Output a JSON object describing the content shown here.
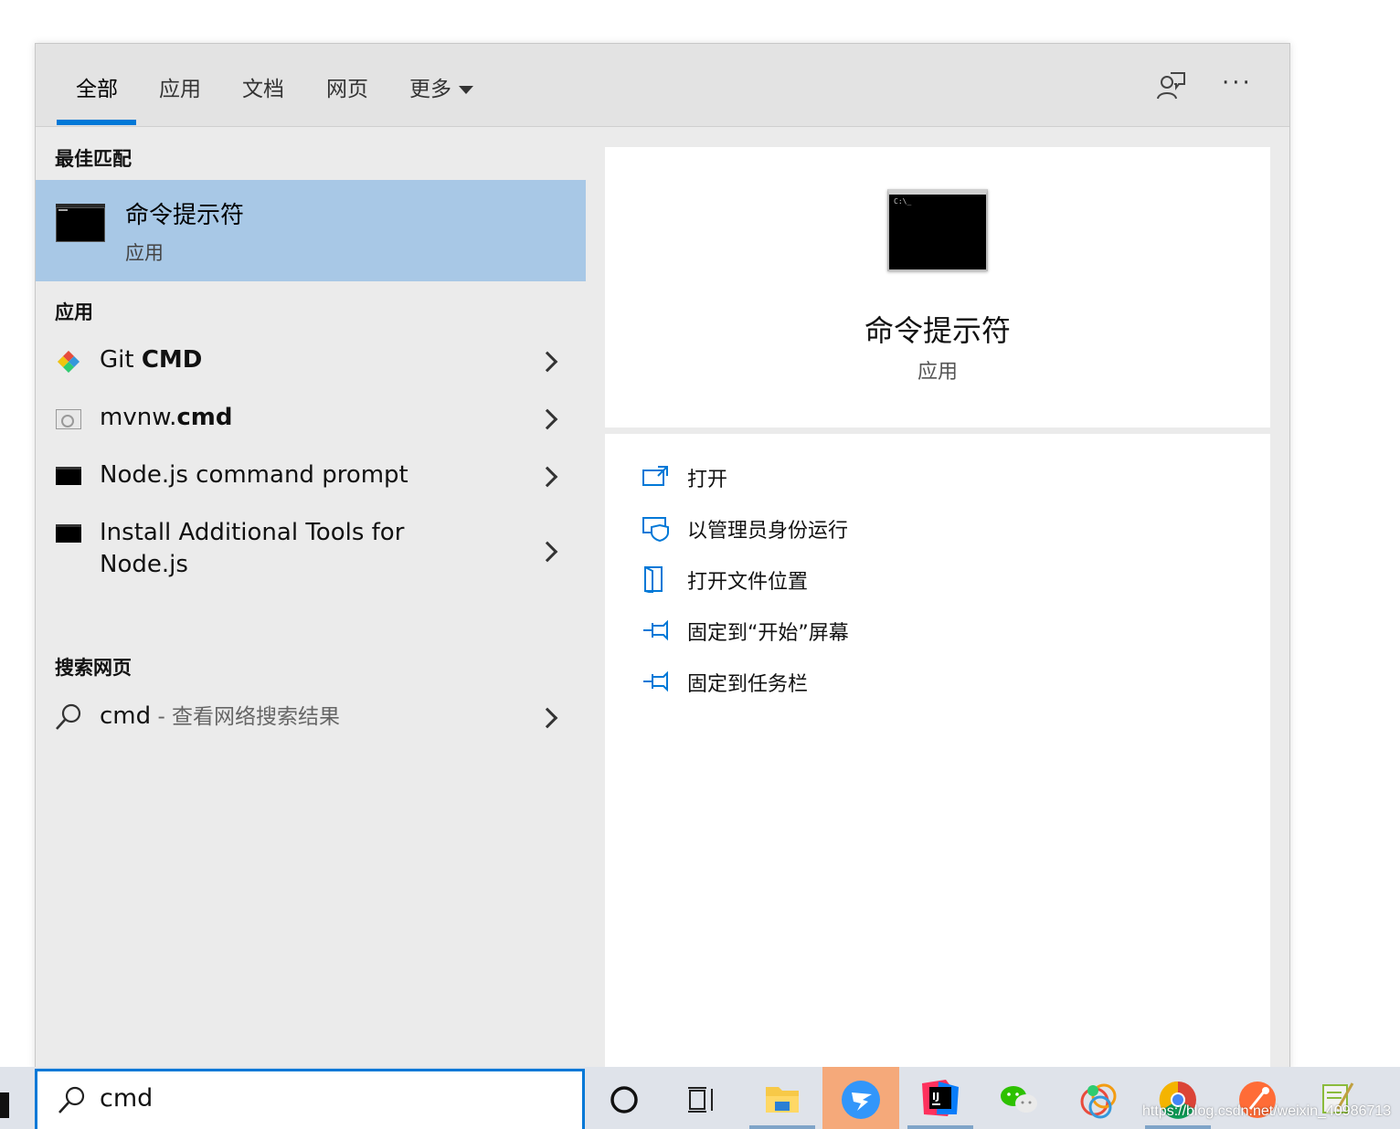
{
  "tabs": [
    {
      "label": "全部"
    },
    {
      "label": "应用"
    },
    {
      "label": "文档"
    },
    {
      "label": "网页"
    },
    {
      "label": "更多"
    }
  ],
  "sections": {
    "best_match": "最佳匹配",
    "apps": "应用",
    "web": "搜索网页"
  },
  "best_match": {
    "title": "命令提示符",
    "subtitle": "应用"
  },
  "apps": [
    {
      "prefix": "Git ",
      "bold": "CMD",
      "suffix": ""
    },
    {
      "prefix": "mvnw.",
      "bold": "cmd",
      "suffix": ""
    },
    {
      "prefix": "Node.js command prompt",
      "bold": "",
      "suffix": ""
    },
    {
      "prefix": "Install Additional Tools for",
      "bold": "",
      "suffix": "Node.js"
    }
  ],
  "web_result": {
    "query": "cmd",
    "sub": " - 查看网络搜索结果"
  },
  "detail": {
    "title": "命令提示符",
    "subtitle": "应用"
  },
  "actions": [
    {
      "label": "打开",
      "icon": "open-icon"
    },
    {
      "label": "以管理员身份运行",
      "icon": "shield-run-icon"
    },
    {
      "label": "打开文件位置",
      "icon": "file-location-icon"
    },
    {
      "label": "固定到“开始”屏幕",
      "icon": "pin-icon"
    },
    {
      "label": "固定到任务栏",
      "icon": "pin-icon"
    }
  ],
  "search": {
    "value": "cmd"
  },
  "watermark": "https://blog.csdn.net/weixin_40986713",
  "colors": {
    "accent": "#0078d7",
    "selected": "#a8c8e6",
    "panel": "#ebebeb"
  }
}
